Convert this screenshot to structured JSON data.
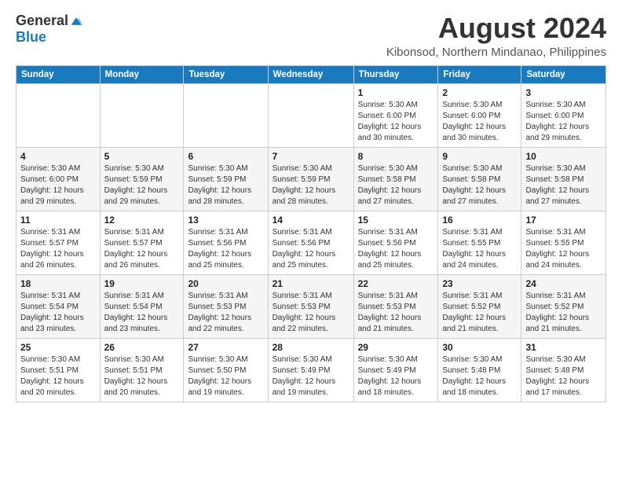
{
  "logo": {
    "general": "General",
    "blue": "Blue"
  },
  "header": {
    "title": "August 2024",
    "subtitle": "Kibonsod, Northern Mindanao, Philippines"
  },
  "weekdays": [
    "Sunday",
    "Monday",
    "Tuesday",
    "Wednesday",
    "Thursday",
    "Friday",
    "Saturday"
  ],
  "weeks": [
    [
      {
        "day": "",
        "info": ""
      },
      {
        "day": "",
        "info": ""
      },
      {
        "day": "",
        "info": ""
      },
      {
        "day": "",
        "info": ""
      },
      {
        "day": "1",
        "info": "Sunrise: 5:30 AM\nSunset: 6:00 PM\nDaylight: 12 hours\nand 30 minutes."
      },
      {
        "day": "2",
        "info": "Sunrise: 5:30 AM\nSunset: 6:00 PM\nDaylight: 12 hours\nand 30 minutes."
      },
      {
        "day": "3",
        "info": "Sunrise: 5:30 AM\nSunset: 6:00 PM\nDaylight: 12 hours\nand 29 minutes."
      }
    ],
    [
      {
        "day": "4",
        "info": "Sunrise: 5:30 AM\nSunset: 6:00 PM\nDaylight: 12 hours\nand 29 minutes."
      },
      {
        "day": "5",
        "info": "Sunrise: 5:30 AM\nSunset: 5:59 PM\nDaylight: 12 hours\nand 29 minutes."
      },
      {
        "day": "6",
        "info": "Sunrise: 5:30 AM\nSunset: 5:59 PM\nDaylight: 12 hours\nand 28 minutes."
      },
      {
        "day": "7",
        "info": "Sunrise: 5:30 AM\nSunset: 5:59 PM\nDaylight: 12 hours\nand 28 minutes."
      },
      {
        "day": "8",
        "info": "Sunrise: 5:30 AM\nSunset: 5:58 PM\nDaylight: 12 hours\nand 27 minutes."
      },
      {
        "day": "9",
        "info": "Sunrise: 5:30 AM\nSunset: 5:58 PM\nDaylight: 12 hours\nand 27 minutes."
      },
      {
        "day": "10",
        "info": "Sunrise: 5:30 AM\nSunset: 5:58 PM\nDaylight: 12 hours\nand 27 minutes."
      }
    ],
    [
      {
        "day": "11",
        "info": "Sunrise: 5:31 AM\nSunset: 5:57 PM\nDaylight: 12 hours\nand 26 minutes."
      },
      {
        "day": "12",
        "info": "Sunrise: 5:31 AM\nSunset: 5:57 PM\nDaylight: 12 hours\nand 26 minutes."
      },
      {
        "day": "13",
        "info": "Sunrise: 5:31 AM\nSunset: 5:56 PM\nDaylight: 12 hours\nand 25 minutes."
      },
      {
        "day": "14",
        "info": "Sunrise: 5:31 AM\nSunset: 5:56 PM\nDaylight: 12 hours\nand 25 minutes."
      },
      {
        "day": "15",
        "info": "Sunrise: 5:31 AM\nSunset: 5:56 PM\nDaylight: 12 hours\nand 25 minutes."
      },
      {
        "day": "16",
        "info": "Sunrise: 5:31 AM\nSunset: 5:55 PM\nDaylight: 12 hours\nand 24 minutes."
      },
      {
        "day": "17",
        "info": "Sunrise: 5:31 AM\nSunset: 5:55 PM\nDaylight: 12 hours\nand 24 minutes."
      }
    ],
    [
      {
        "day": "18",
        "info": "Sunrise: 5:31 AM\nSunset: 5:54 PM\nDaylight: 12 hours\nand 23 minutes."
      },
      {
        "day": "19",
        "info": "Sunrise: 5:31 AM\nSunset: 5:54 PM\nDaylight: 12 hours\nand 23 minutes."
      },
      {
        "day": "20",
        "info": "Sunrise: 5:31 AM\nSunset: 5:53 PM\nDaylight: 12 hours\nand 22 minutes."
      },
      {
        "day": "21",
        "info": "Sunrise: 5:31 AM\nSunset: 5:53 PM\nDaylight: 12 hours\nand 22 minutes."
      },
      {
        "day": "22",
        "info": "Sunrise: 5:31 AM\nSunset: 5:53 PM\nDaylight: 12 hours\nand 21 minutes."
      },
      {
        "day": "23",
        "info": "Sunrise: 5:31 AM\nSunset: 5:52 PM\nDaylight: 12 hours\nand 21 minutes."
      },
      {
        "day": "24",
        "info": "Sunrise: 5:31 AM\nSunset: 5:52 PM\nDaylight: 12 hours\nand 21 minutes."
      }
    ],
    [
      {
        "day": "25",
        "info": "Sunrise: 5:30 AM\nSunset: 5:51 PM\nDaylight: 12 hours\nand 20 minutes."
      },
      {
        "day": "26",
        "info": "Sunrise: 5:30 AM\nSunset: 5:51 PM\nDaylight: 12 hours\nand 20 minutes."
      },
      {
        "day": "27",
        "info": "Sunrise: 5:30 AM\nSunset: 5:50 PM\nDaylight: 12 hours\nand 19 minutes."
      },
      {
        "day": "28",
        "info": "Sunrise: 5:30 AM\nSunset: 5:49 PM\nDaylight: 12 hours\nand 19 minutes."
      },
      {
        "day": "29",
        "info": "Sunrise: 5:30 AM\nSunset: 5:49 PM\nDaylight: 12 hours\nand 18 minutes."
      },
      {
        "day": "30",
        "info": "Sunrise: 5:30 AM\nSunset: 5:48 PM\nDaylight: 12 hours\nand 18 minutes."
      },
      {
        "day": "31",
        "info": "Sunrise: 5:30 AM\nSunset: 5:48 PM\nDaylight: 12 hours\nand 17 minutes."
      }
    ]
  ]
}
